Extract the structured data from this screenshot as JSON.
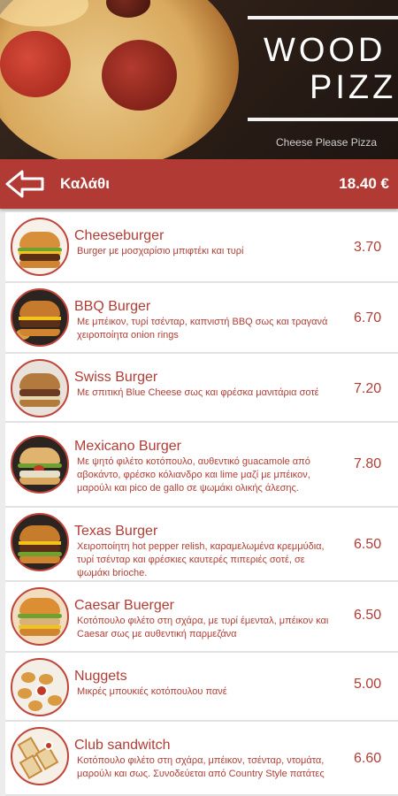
{
  "banner": {
    "title_line1": "WOOD",
    "title_line2": "PIZZ",
    "subtitle": "Cheese Please Pizza"
  },
  "cart": {
    "back_icon": "back-arrow-icon",
    "title": "Καλάθι",
    "total": "18.40 €"
  },
  "colors": {
    "accent": "#b23a34",
    "text": "#b13d36",
    "background": "#ececec"
  },
  "items": [
    {
      "name": "Cheeseburger",
      "desc": "Burger με μοσχαρίσιο μπιφτέκι και τυρί",
      "price": "3.70"
    },
    {
      "name": "BBQ Burger",
      "desc": "Με μπέικον, τυρί τσένταρ, καπνιστή BBQ σως και τραγανά χειροποίητα onion rings",
      "price": "6.70"
    },
    {
      "name": "Swiss Burger",
      "desc": "Με σπιτική Blue Cheese σως και φρέσκα μανιτάρια σοτέ",
      "price": "7.20"
    },
    {
      "name": "Mexicano Burger",
      "desc": "Με ψητό φιλέτο κοτόπουλο, αυθεντικό guacamole από αβοκάντο, φρέσκο κόλιανδρο και lime μαζί με μπέικον, μαρούλι και pico de gallo σε ψωμάκι ολικής άλεσης.",
      "price": "7.80"
    },
    {
      "name": "Texas Burger",
      "desc": "Χειροποίητη hot pepper relish, καραμελωμένα κρεμμύδια, τυρί τσένταρ και φρέσκιες καυτερές πιπεριές σοτέ, σε ψωμάκι brioche.",
      "price": "6.50"
    },
    {
      "name": "Caesar Buerger",
      "desc": "Κοτόπουλο φιλέτο στη σχάρα, με τυρί έμενταλ, μπέικον και Caesar σως με αυθεντική παρμεζάνα",
      "price": "6.50"
    },
    {
      "name": "Nuggets",
      "desc": "Μικρές μπουκιές κοτόπουλου πανέ",
      "price": "5.00"
    },
    {
      "name": "Club sandwitch",
      "desc": "Κοτόπουλο φιλέτο στη σχάρα, μπέικον, τσένταρ, ντομάτα, μαρούλι και σως. Συνοδεύεται από Country Style πατάτες",
      "price": "6.60"
    }
  ]
}
